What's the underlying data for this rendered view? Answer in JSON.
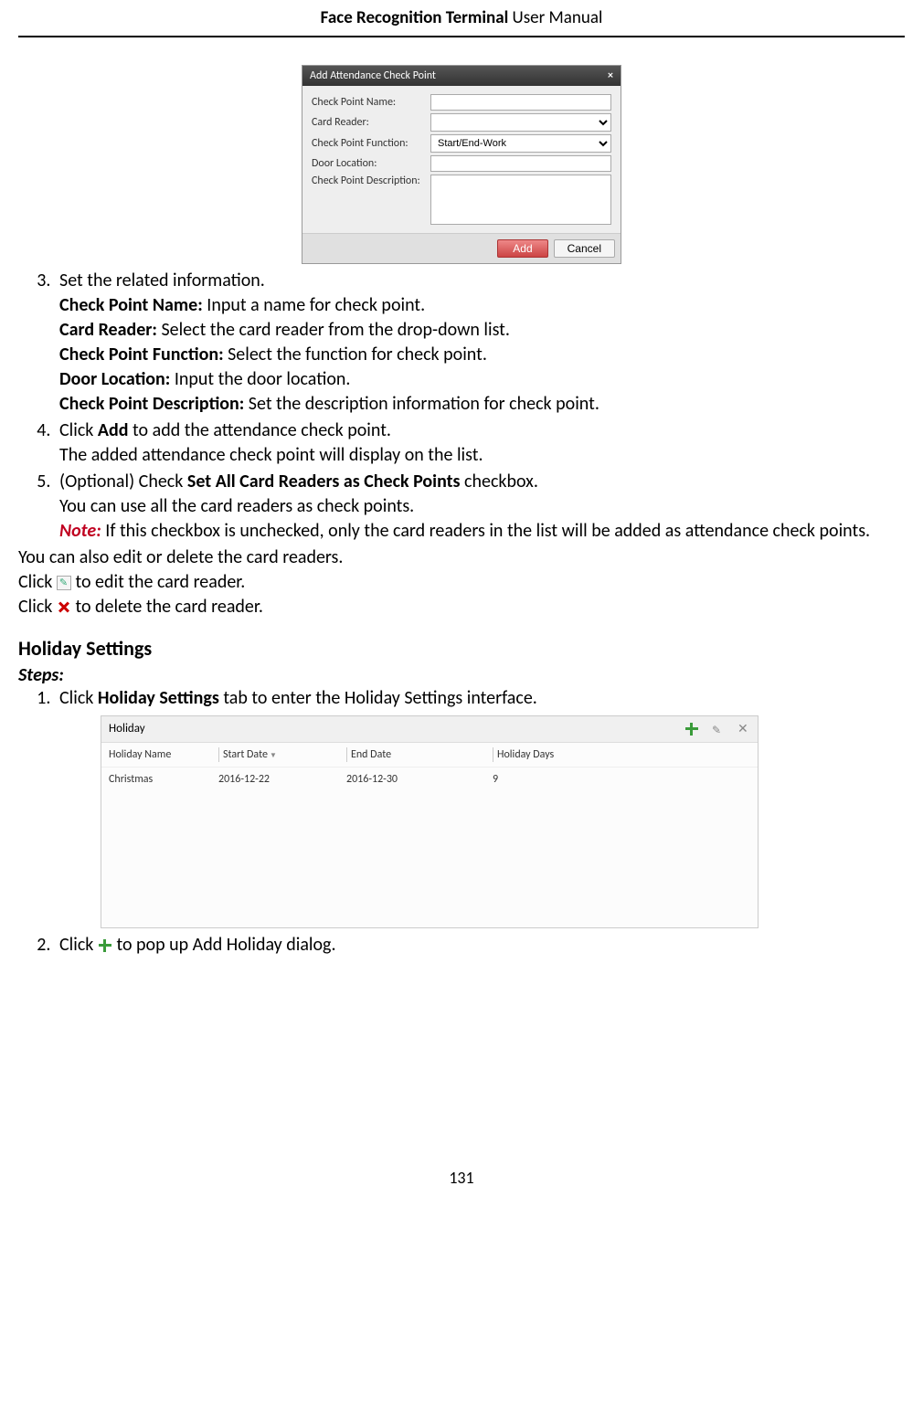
{
  "header": {
    "bold": "Face Recognition Terminal",
    "rest": "  User Manual"
  },
  "dialog": {
    "title": "Add Attendance Check Point",
    "fields": {
      "name_label": "Check Point Name:",
      "reader_label": "Card Reader:",
      "func_label": "Check Point Function:",
      "func_value": "Start/End-Work",
      "loc_label": "Door Location:",
      "desc_label": "Check Point Description:"
    },
    "add": "Add",
    "cancel": "Cancel"
  },
  "step3": {
    "lead": "Set the related information.",
    "l1b": "Check Point Name:",
    "l1": " Input a name for check point.",
    "l2b": "Card Reader:",
    "l2": " Select the card reader from the drop-down list.",
    "l3b": "Check Point Function:",
    "l3": " Select the function for check point.",
    "l4b": "Door Location:",
    "l4": " Input the door location.",
    "l5b": "Check Point Description:",
    "l5": " Set the description information for check point."
  },
  "step4": {
    "a1": "Click ",
    "a2": "Add",
    "a3": " to add the attendance check point.",
    "b": "The added attendance check point will display on the list."
  },
  "step5": {
    "a1": "(Optional) Check ",
    "a2": "Set All Card Readers as Check Points",
    "a3": " checkbox.",
    "b": "You can use all the card readers as check points.",
    "note": "Note:",
    "noteText": " If this checkbox is unchecked, only the card readers in the list will be added as attendance check points."
  },
  "after": {
    "l1": "You can also edit or delete the card readers.",
    "l2a": "Click ",
    "l2b": " to edit the card reader.",
    "l3a": "Click ",
    "l3b": " to delete the card reader."
  },
  "section2": {
    "title": "Holiday Settings",
    "steps": "Steps:",
    "s1a": "Click ",
    "s1b": "Holiday Settings",
    "s1c": " tab to enter the Holiday Settings interface.",
    "s2a": "Click ",
    "s2b": " to pop up Add Holiday dialog."
  },
  "holiday": {
    "panelTitle": "Holiday",
    "cols": {
      "name": "Holiday Name",
      "start": "Start Date",
      "end": "End Date",
      "days": "Holiday Days"
    },
    "row": {
      "name": "Christmas",
      "start": "2016-12-22",
      "end": "2016-12-30",
      "days": "9"
    }
  },
  "pageNumber": "131"
}
